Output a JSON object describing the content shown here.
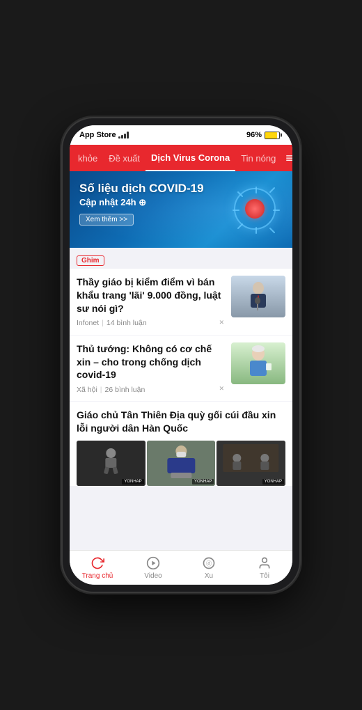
{
  "status_bar": {
    "carrier": "App Store",
    "signal": "full",
    "battery": "96%",
    "battery_color": "#ffd60a"
  },
  "nav": {
    "items": [
      {
        "id": "suc-khoe",
        "label": "khỏe",
        "active": false
      },
      {
        "id": "de-xuat",
        "label": "Đề xuất",
        "active": false
      },
      {
        "id": "dich-virus",
        "label": "Dịch Virus Corona",
        "active": true
      },
      {
        "id": "tin-nong",
        "label": "Tin nóng",
        "active": false
      }
    ],
    "menu_icon": "≡"
  },
  "banner": {
    "title": "Số liệu dịch COVID-19",
    "subtitle": "Cập nhật 24h ⊕",
    "button_label": "Xem thêm >>"
  },
  "pin_label": "Ghim",
  "news_items": [
    {
      "id": "news-1",
      "title": "Thầy giáo bị kiểm điểm vì bán khẩu trang 'lãi' 9.000 đồng, luật sư nói gì?",
      "source": "Infonet",
      "comments": "14 bình luận",
      "has_thumb": true,
      "thumb_type": "person1"
    },
    {
      "id": "news-2",
      "title": "Thủ tướng: Không có cơ chế xin – cho trong chống dịch covid-19",
      "source": "Xã hội",
      "comments": "26 bình luận",
      "has_thumb": true,
      "thumb_type": "person2"
    },
    {
      "id": "news-3",
      "title": "Giáo chủ Tân Thiên Địa quỳ gối cúi đầu xin lỗi người dân Hàn Quốc",
      "source": "",
      "comments": "",
      "has_images": true,
      "images": [
        "dark1",
        "medium",
        "dark2"
      ]
    }
  ],
  "tabs": [
    {
      "id": "trang-chu",
      "label": "Trang chủ",
      "icon": "refresh",
      "active": true
    },
    {
      "id": "video",
      "label": "Video",
      "icon": "play",
      "active": false
    },
    {
      "id": "xu",
      "label": "Xu",
      "icon": "diamond",
      "active": false
    },
    {
      "id": "toi",
      "label": "Tôi",
      "icon": "person",
      "active": false
    }
  ]
}
